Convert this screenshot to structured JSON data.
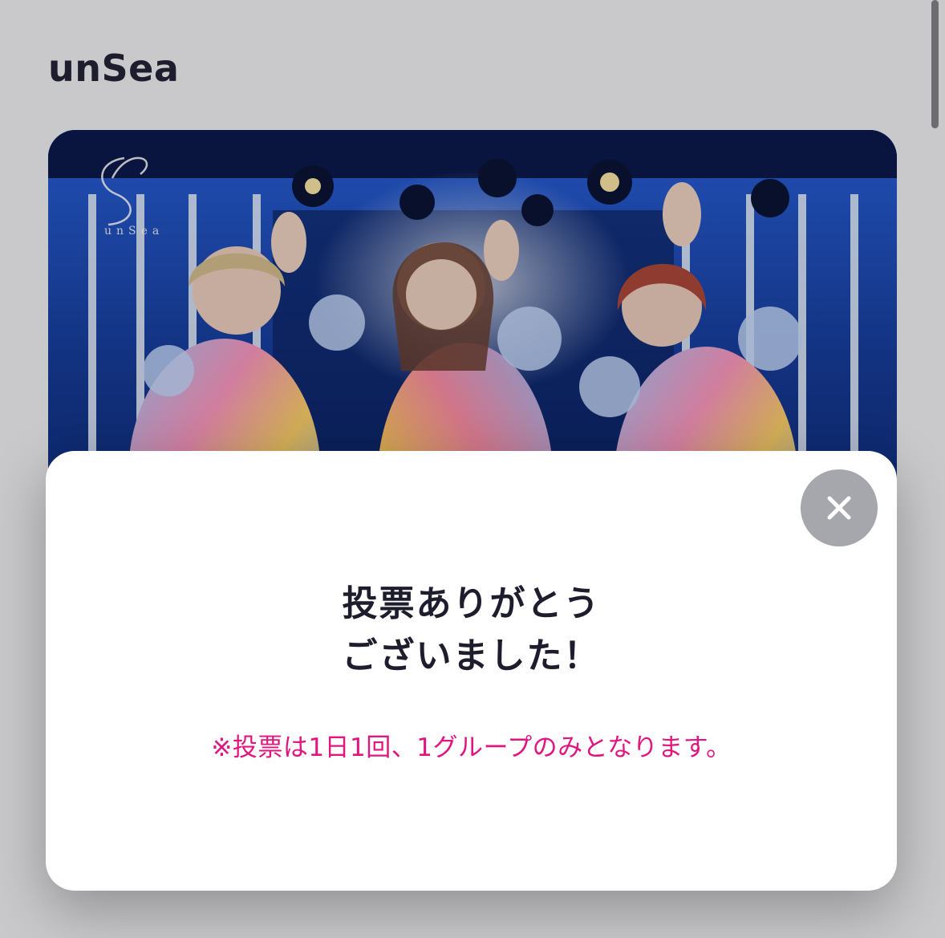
{
  "header": {
    "title": "unSea"
  },
  "card": {
    "image_description_icon": "group-photo",
    "logo_icon": "unsea-logo-icon",
    "logo_text": "unSea"
  },
  "modal": {
    "heading_line1": "投票ありがとう",
    "heading_line2": "ございました！",
    "note": "※投票は1日1回、1グループのみとなります。",
    "close_icon": "close-icon"
  },
  "colors": {
    "background": "#c9c9cb",
    "title_text": "#1d1d2e",
    "note_text": "#e0157f",
    "close_button": "#a6a6ad",
    "stage_blue": "#1a47b8"
  }
}
